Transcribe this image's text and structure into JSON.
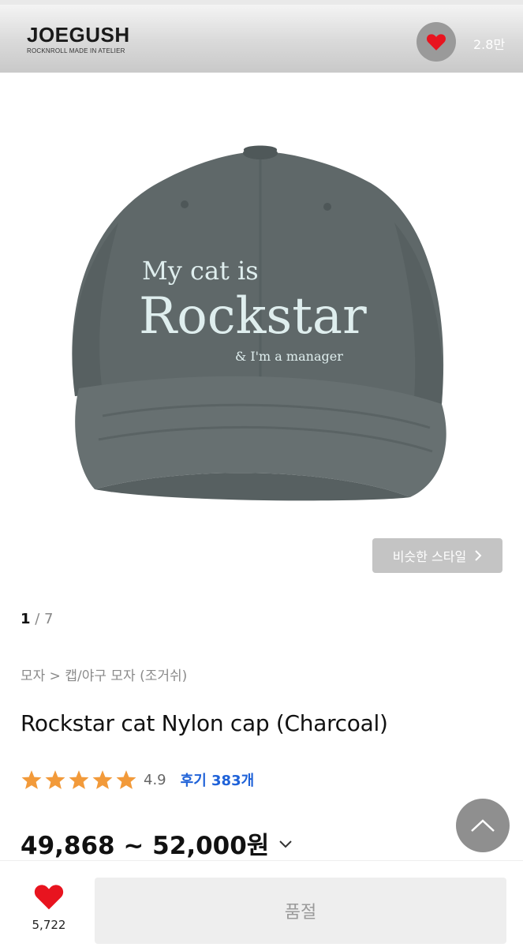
{
  "header": {
    "brand_name": "JOEGUSH",
    "brand_tagline": "ROCKNROLL MADE IN ATELIER",
    "favorite_count": "2.8만",
    "icons": {
      "favorite": "heart-icon"
    }
  },
  "product_image": {
    "embroidery_line1": "My cat is",
    "embroidery_line2": "Rockstar",
    "embroidery_line3": "& I'm a manager"
  },
  "similar_style_button": "비슷한 스타일",
  "pager": {
    "current": "1",
    "separator": " / ",
    "total": "7"
  },
  "breadcrumb": "모자 > 캡/야구 모자 (조거쉬)",
  "product_title": "Rockstar cat Nylon cap (Charcoal)",
  "rating": {
    "value": "4.9",
    "stars_filled": 5,
    "reviews_label": "후기 383개"
  },
  "price": "49,868 ~ 52,000원",
  "bottom_bar": {
    "like_count": "5,722",
    "soldout_label": "품절"
  },
  "colors": {
    "accent_blue": "#1f62d8",
    "heart_red": "#e8141f",
    "star_orange": "#f29a3a",
    "cap_charcoal": "#5f6869"
  }
}
